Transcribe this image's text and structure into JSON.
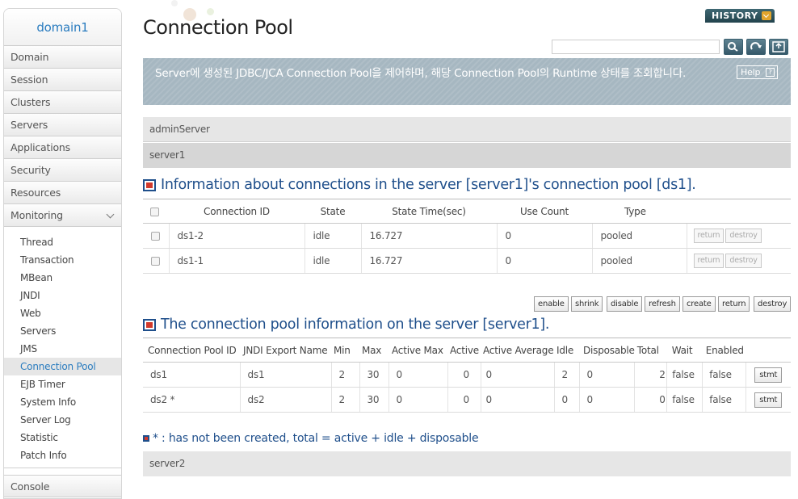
{
  "sidebar": {
    "domain": "domain1",
    "items": [
      "Domain",
      "Session",
      "Clusters",
      "Servers",
      "Applications",
      "Security",
      "Resources",
      "Monitoring"
    ],
    "monitoring_sub": [
      "Thread",
      "Transaction",
      "MBean",
      "JNDI",
      "Web",
      "Servers",
      "JMS",
      "Connection Pool",
      "EJB Timer",
      "System Info",
      "Server Log",
      "Statistic",
      "Patch Info"
    ],
    "active_sub": "Connection Pool",
    "bottom": "Console"
  },
  "header": {
    "title": "Connection Pool",
    "history": "HISTORY",
    "search_placeholder": ""
  },
  "banner": {
    "text": "Server에 생성된 JDBC/JCA Connection Pool을 제어하며, 해당 Connection Pool의 Runtime 상태를 조회합니다.",
    "help": "Help",
    "help_q": "?"
  },
  "servers": {
    "admin": "adminServer",
    "server1": "server1",
    "server2": "server2"
  },
  "section1": {
    "title": "Information about connections in the server [server1]'s connection pool [ds1].",
    "columns": [
      "Connection ID",
      "State",
      "State Time(sec)",
      "Use Count",
      "Type"
    ],
    "rows": [
      {
        "id": "ds1-2",
        "state": "idle",
        "time": "16.727",
        "use": "0",
        "type": "pooled"
      },
      {
        "id": "ds1-1",
        "state": "idle",
        "time": "16.727",
        "use": "0",
        "type": "pooled"
      }
    ],
    "row_buttons": [
      "return",
      "destroy"
    ]
  },
  "actions": [
    "enable",
    "shrink",
    "disable",
    "refresh",
    "create",
    "return",
    "destroy"
  ],
  "section2": {
    "title": "The connection pool information on the server [server1].",
    "columns": [
      "Connection Pool ID",
      "JNDI Export Name",
      "Min",
      "Max",
      "Active Max",
      "Active",
      "Active Average",
      "Idle",
      "Disposable",
      "Total",
      "Wait",
      "Enabled"
    ],
    "rows": [
      {
        "id": "ds1",
        "jndi": "ds1",
        "min": "2",
        "max": "30",
        "amax": "0",
        "active": "0",
        "aavg": "0",
        "idle": "2",
        "disp": "0",
        "total": "2",
        "wait": "false",
        "enabled": "false"
      },
      {
        "id": "ds2 *",
        "jndi": "ds2",
        "min": "2",
        "max": "30",
        "amax": "0",
        "active": "0",
        "aavg": "0",
        "idle": "0",
        "disp": "0",
        "total": "0",
        "wait": "false",
        "enabled": "false"
      }
    ],
    "stmt": "stmt"
  },
  "note": "* : has not been created, total = active + idle + disposable"
}
